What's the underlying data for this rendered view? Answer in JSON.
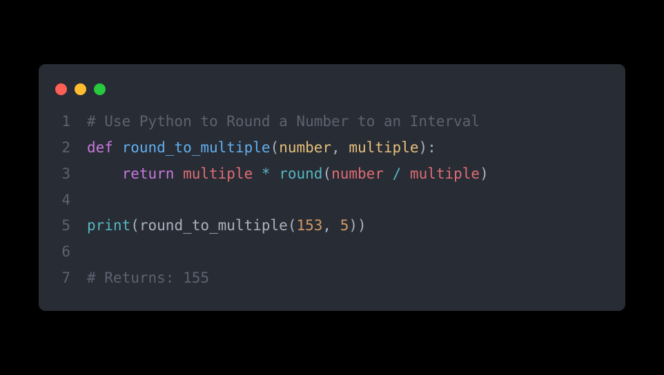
{
  "lines": {
    "l1": {
      "num": "1",
      "comment": "# Use Python to Round a Number to an Interval"
    },
    "l2": {
      "num": "2",
      "def": "def",
      "fn": "round_to_multiple",
      "p1": "number",
      "p2": "multiple"
    },
    "l3": {
      "num": "3",
      "ret": "return",
      "a": "multiple",
      "op": "*",
      "round": "round",
      "b": "number",
      "div": "/",
      "c": "multiple"
    },
    "l4": {
      "num": "4"
    },
    "l5": {
      "num": "5",
      "print": "print",
      "fn": "round_to_multiple",
      "n1": "153",
      "n2": "5"
    },
    "l6": {
      "num": "6"
    },
    "l7": {
      "num": "7",
      "comment": "# Returns: 155"
    }
  }
}
